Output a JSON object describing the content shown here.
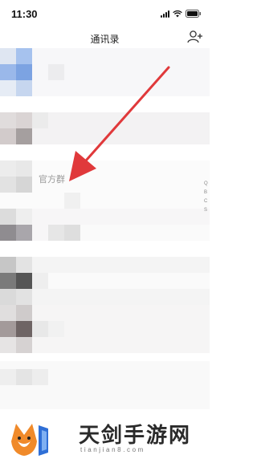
{
  "status_bar": {
    "time": "11:30"
  },
  "header": {
    "title": "通讯录"
  },
  "highlighted_contact": {
    "name": "官方群"
  },
  "index_bar": {
    "letters": [
      "Q",
      "B",
      "C",
      "S"
    ]
  },
  "watermark": {
    "brand": "天剑手游网",
    "url": "tianjian8.com"
  },
  "colors": {
    "arrow": "#e0393b",
    "text": "#222222"
  }
}
